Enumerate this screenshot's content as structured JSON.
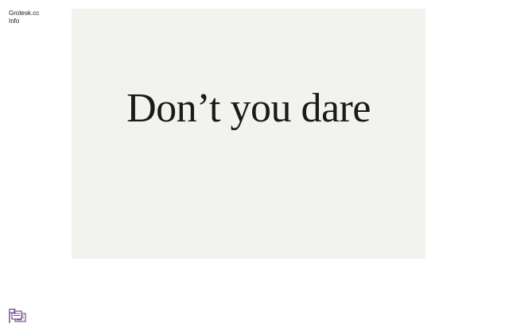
{
  "nav": {
    "site_name": "Grotesk.cc",
    "info_label": "Info"
  },
  "hero": {
    "headline": "Don’t you dare"
  },
  "colors": {
    "card_background": "#f2f2ef",
    "text": "#1a1a1a",
    "badge_accent": "#5b2a6e"
  },
  "badge": {
    "icon": "flag-stack-icon"
  }
}
